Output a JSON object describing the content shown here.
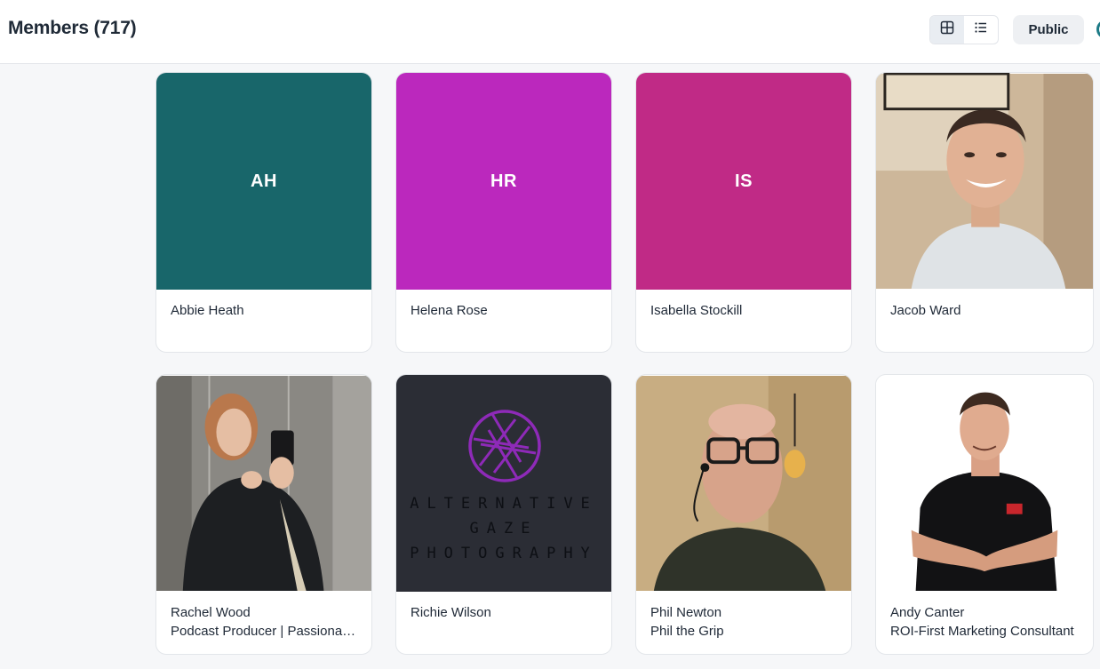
{
  "header": {
    "title": "Members (717)",
    "public_label": "Public",
    "grid_view_icon": "grid-view-icon",
    "list_view_icon": "list-view-icon"
  },
  "members": [
    {
      "name": "Abbie Heath",
      "initials": "AH",
      "avatar_color": "#18666a",
      "tagline": ""
    },
    {
      "name": "Helena Rose",
      "initials": "HR",
      "avatar_color": "#bb28bd",
      "tagline": ""
    },
    {
      "name": "Isabella Stockill",
      "initials": "IS",
      "avatar_color": "#c02a86",
      "tagline": ""
    },
    {
      "name": "Jacob Ward",
      "initials": "",
      "avatar_color": "",
      "tagline": ""
    },
    {
      "name": "Rachel Wood",
      "initials": "",
      "avatar_color": "",
      "tagline": "Podcast Producer | Passionate about podcasting"
    },
    {
      "name": "Richie Wilson",
      "initials": "",
      "avatar_color": "",
      "tagline": "",
      "logo_lines": [
        "ALTERNATIVE",
        "GAZE",
        "PHOTOGRAPHY"
      ]
    },
    {
      "name": "Phil Newton",
      "initials": "",
      "avatar_color": "",
      "tagline": "Phil the Grip"
    },
    {
      "name": "Andy Canter",
      "initials": "",
      "avatar_color": "",
      "tagline": "ROI-First Marketing Consultant"
    }
  ],
  "colors": {
    "accent_ring": "#1c7a86",
    "logo_purple": "#8e2ab8",
    "logo_bg": "#2b2d35"
  }
}
